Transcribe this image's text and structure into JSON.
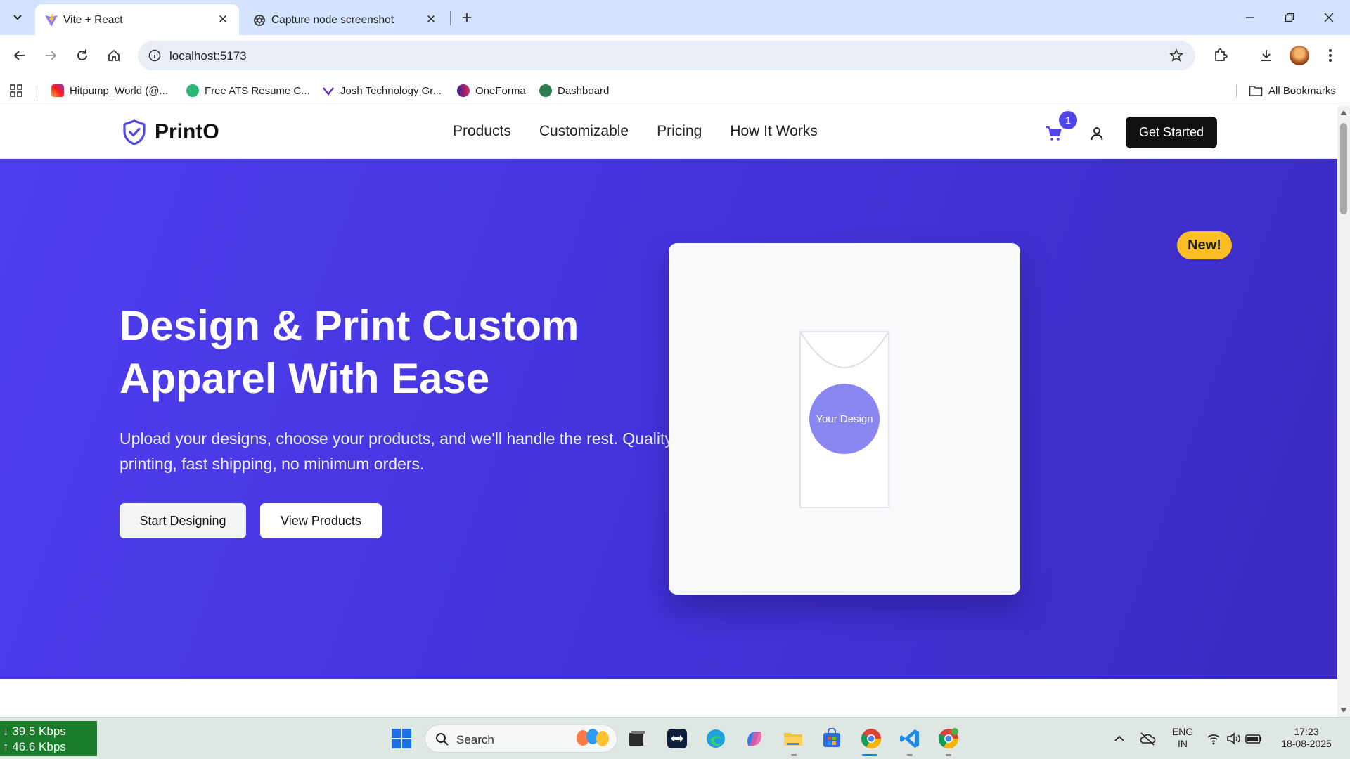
{
  "browser": {
    "tabs": [
      {
        "title": "Vite + React",
        "icon": "vite-icon",
        "active": true
      },
      {
        "title": "Capture node screenshot",
        "icon": "openai-icon",
        "active": false
      }
    ],
    "url": "localhost:5173",
    "bookmarks": [
      {
        "label": "Hitpump_World (@...",
        "icon": "instagram-icon"
      },
      {
        "label": "Free ATS Resume C...",
        "icon": "resume-icon"
      },
      {
        "label": "Josh Technology Gr...",
        "icon": "josh-icon"
      },
      {
        "label": "OneForma",
        "icon": "oneforma-icon"
      },
      {
        "label": "Dashboard",
        "icon": "dashboard-icon"
      }
    ],
    "all_bookmarks_label": "All Bookmarks"
  },
  "site": {
    "brand": "PrintO",
    "nav_links": [
      "Products",
      "Customizable",
      "Pricing",
      "How It Works"
    ],
    "cart_count": "1",
    "cta": "Get Started",
    "accent_color": "#4f46e5"
  },
  "hero": {
    "title": "Design & Print Custom Apparel With Ease",
    "subtitle": "Upload your designs, choose your products, and we'll handle the rest. Quality printing, fast shipping, no minimum orders.",
    "primary_button": "Start Designing",
    "secondary_button": "View Products",
    "design_label": "Your Design",
    "badge": "New!"
  },
  "taskbar": {
    "download_speed": "39.5 Kbps",
    "upload_speed": "46.6 Kbps",
    "search_label": "Search",
    "language": "ENG",
    "region": "IN",
    "time": "17:23",
    "date": "18-08-2025"
  }
}
